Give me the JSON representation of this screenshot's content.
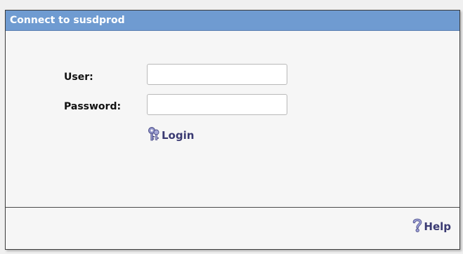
{
  "dialog": {
    "title": "Connect to susdprod"
  },
  "form": {
    "user_label": "User:",
    "user_value": "",
    "password_label": "Password:",
    "password_value": ""
  },
  "actions": {
    "login_label": "Login",
    "login_icon": "keys-icon",
    "help_label": "Help",
    "help_icon": "question-mark-icon"
  },
  "colors": {
    "titlebar": "#6f9bd1",
    "dialog_background": "#f6f6f6",
    "button_text": "#3a3a72"
  }
}
